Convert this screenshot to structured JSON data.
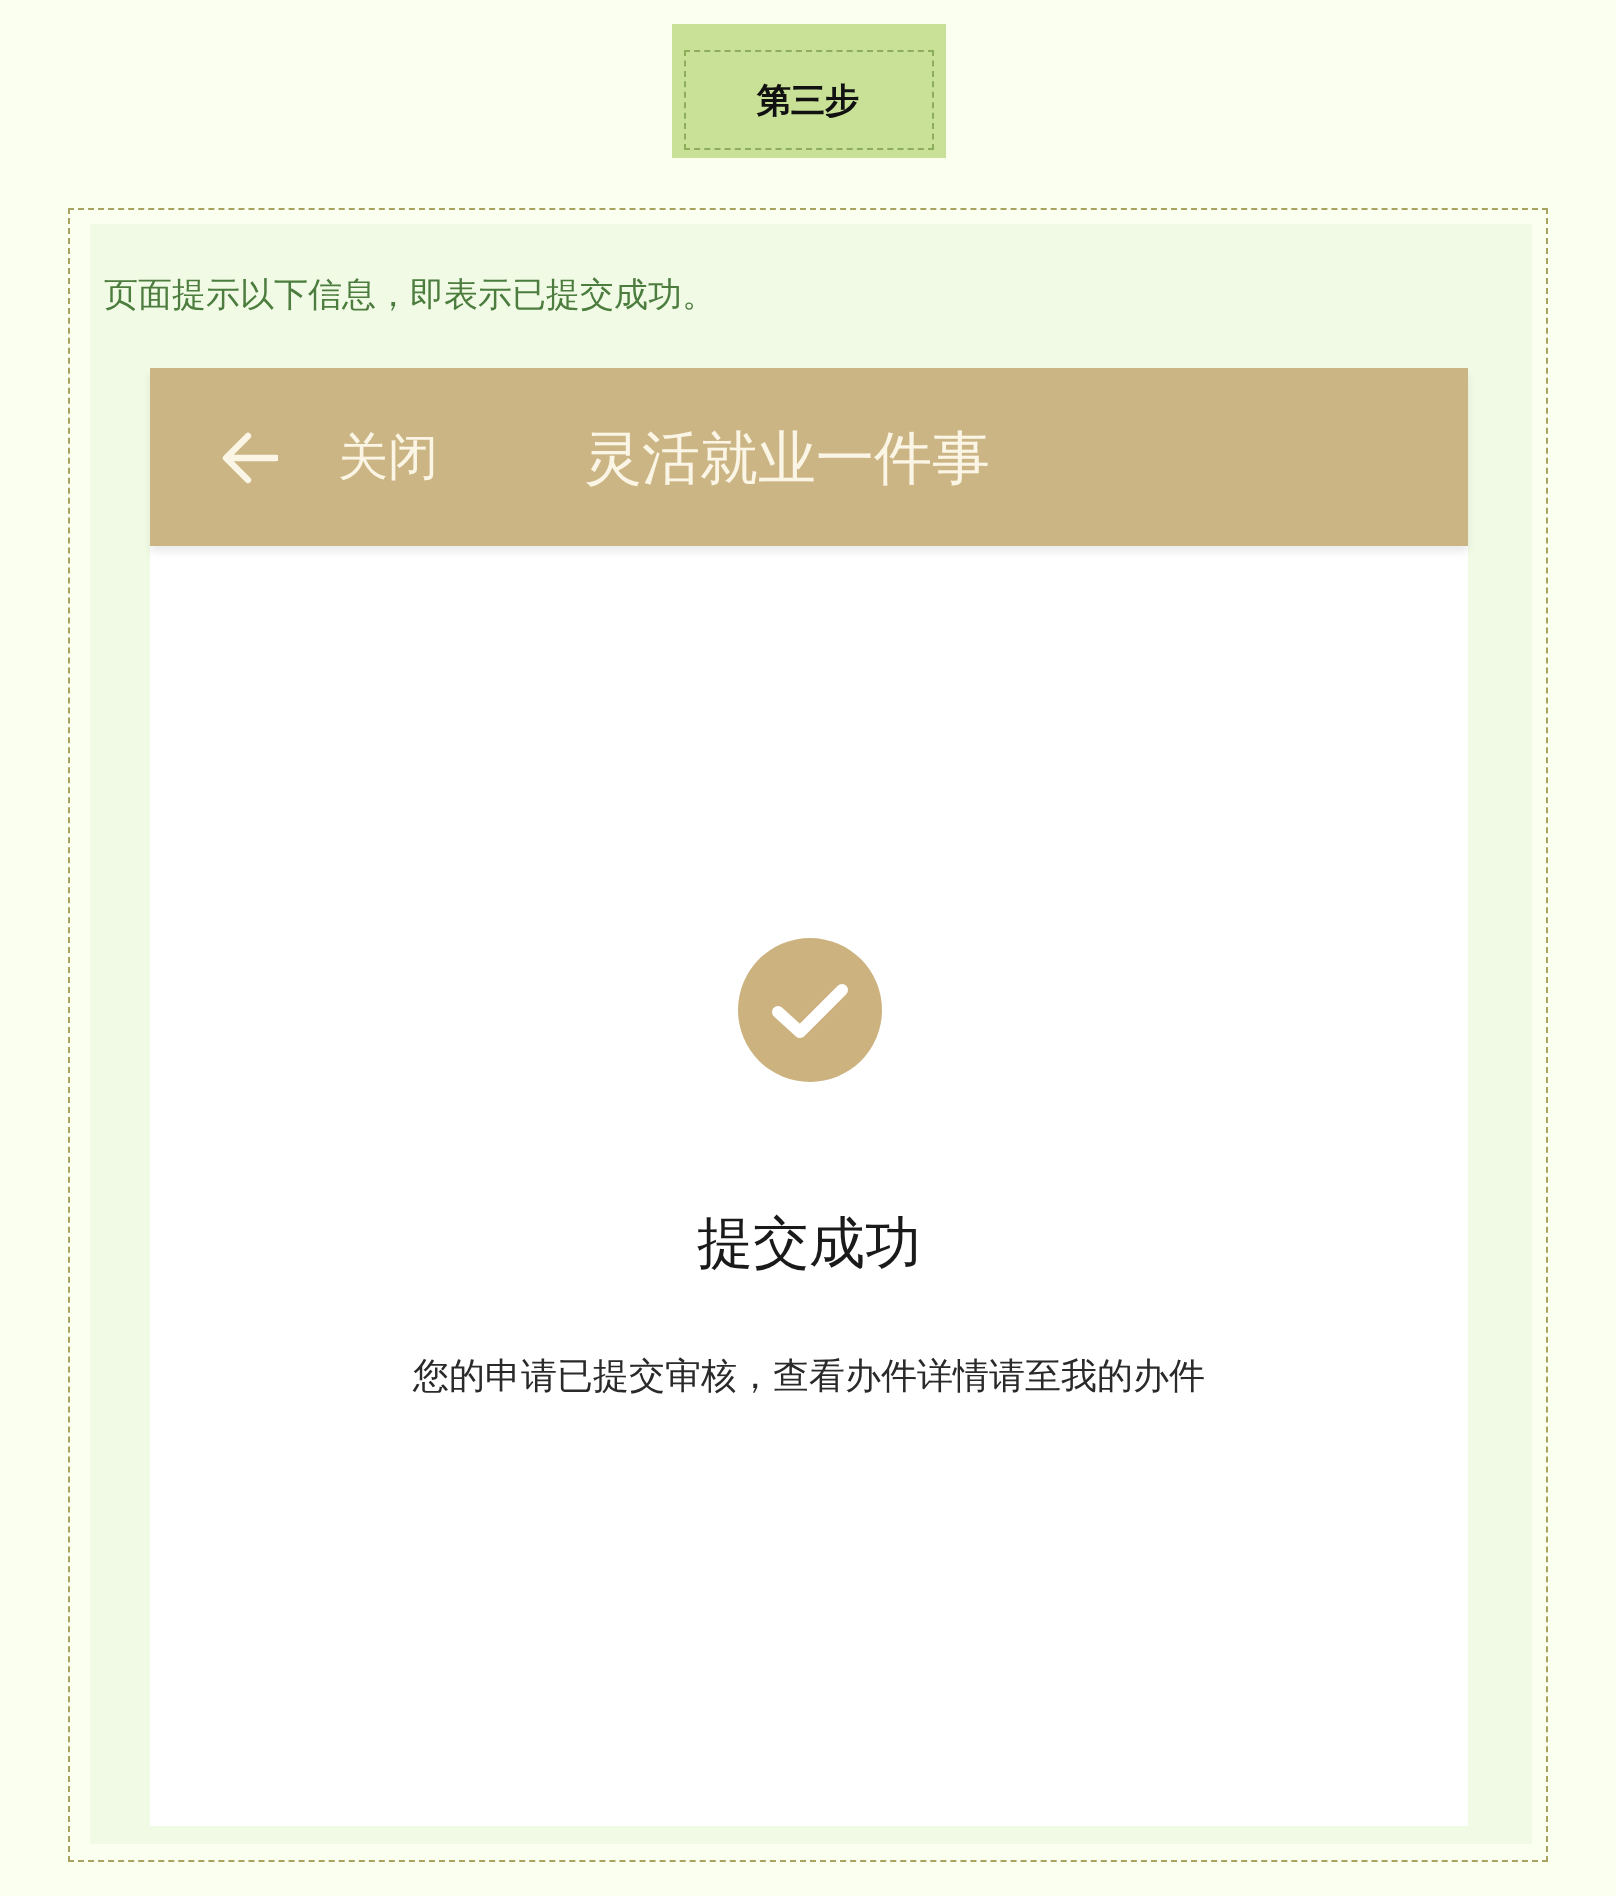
{
  "step_badge": {
    "label": "第三步"
  },
  "instruction": "页面提示以下信息，即表示已提交成功。",
  "screenshot": {
    "header": {
      "close_label": "关闭",
      "title": "灵活就业一件事"
    },
    "result": {
      "title": "提交成功",
      "message": "您的申请已提交审核，查看办件详情请至我的办件"
    }
  }
}
